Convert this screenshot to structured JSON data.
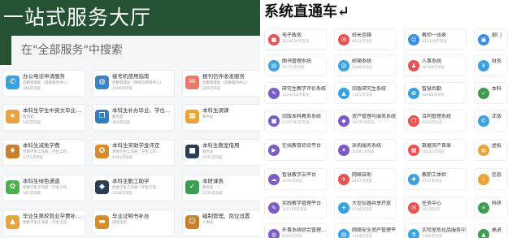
{
  "left_panel": {
    "title": "一站式服务大厅",
    "search_placeholder": "在\"全部服务\"中搜索",
    "cards": [
      {
        "title": "办公电话申请服务",
        "sub": "后勤管理处（后勤服务中心）",
        "count": "346次浏览",
        "icon": "phone-icon",
        "glyph": "✆",
        "color": "#3aa1e0"
      },
      {
        "title": "缓考机使用指南",
        "sub": "后勤管理处（网络与教育中心）",
        "count": "1490次浏览",
        "icon": "globe-icon",
        "glyph": "◍",
        "color": "#3b82c4"
      },
      {
        "title": "报刊信件收发服务",
        "sub": "后勤管理处（后勤服务中心）",
        "count": "224次浏览",
        "icon": "mail-icon",
        "glyph": "✉",
        "color": "#e9776a"
      },
      {
        "title": "本科生学生中英文毕业…",
        "sub": "教务处",
        "count": "502次浏览",
        "icon": "certificate-icon",
        "glyph": "★",
        "color": "#e8a33a"
      },
      {
        "title": "本科生补办毕业、学位…",
        "sub": "教务处",
        "count": "355次浏览",
        "icon": "document-icon",
        "glyph": "❐",
        "color": "#2f7fbf"
      },
      {
        "title": "本科生调课",
        "sub": "教务处",
        "count": "",
        "icon": "schedule-icon",
        "glyph": "▦",
        "color": "#e8a33a"
      },
      {
        "title": "本科生减免学费",
        "sub": "党委学生工作部（学生工作…",
        "count": "1371次浏览",
        "icon": "shield-icon",
        "glyph": "♦",
        "color": "#c9802a"
      },
      {
        "title": "本科生奖助学金评定",
        "sub": "党委学生工作部（学生工作…",
        "count": "4191次浏览",
        "icon": "award-icon",
        "glyph": "✪",
        "color": "#d98b2b"
      },
      {
        "title": "本科生教室借用",
        "sub": "教务处",
        "count": "3743次浏览",
        "icon": "classroom-icon",
        "glyph": "■",
        "color": "#2b3d52"
      },
      {
        "title": "本科生绿色通道",
        "sub": "党委学生工作部（学生工作…",
        "count": "343次浏览",
        "icon": "leaf-icon",
        "glyph": "✿",
        "color": "#4caf50"
      },
      {
        "title": "本科生勤工助学",
        "sub": "党委学生工作部（学生工作…",
        "count": "3336次浏览",
        "icon": "stack-icon",
        "glyph": "◆",
        "color": "#2b3d52"
      },
      {
        "title": "本研课表",
        "sub": "教务处",
        "count": "3735次浏览",
        "icon": "book-icon",
        "glyph": "✓",
        "color": "#3f9b4f"
      },
      {
        "title": "毕业生离校就业学费补…",
        "sub": "党委学生工作部（学生工作…",
        "count": "",
        "icon": "graduation-icon",
        "glyph": "▲",
        "color": "#e8a33a"
      },
      {
        "title": "毕业证明书补办",
        "sub": "研究生院",
        "count": "",
        "icon": "diploma-icon",
        "glyph": "▬",
        "color": "#d98b2b"
      },
      {
        "title": "编制管理、岗位设置",
        "sub": "人事处",
        "count": "",
        "icon": "user-icon",
        "glyph": "☺",
        "color": "#c9802a"
      }
    ]
  },
  "right_panel": {
    "title": "系统直通车↵",
    "cards": [
      {
        "title": "电子政务",
        "count": "1634220次浏览",
        "icon": "government-icon",
        "glyph": "■",
        "color": "#e55353"
      },
      {
        "title": "校长信箱",
        "count": "6932次浏览",
        "icon": "mailbox-icon",
        "glyph": "✉",
        "color": "#e55353"
      },
      {
        "title": "教师一张表",
        "count": "311328次浏览",
        "icon": "form-icon",
        "glyph": "☺",
        "color": "#3a8ee0"
      },
      {
        "title": "部门",
        "count": "",
        "icon": "department-icon",
        "glyph": "▣",
        "color": "#3a8ee0"
      },
      {
        "title": "图书管理系统",
        "count": "74779次浏览",
        "icon": "library-icon",
        "glyph": "▤",
        "color": "#3aa1e0"
      },
      {
        "title": "邮箱系统",
        "count": "2008次浏览",
        "icon": "email-icon",
        "glyph": "@",
        "color": "#3aa1e0"
      },
      {
        "title": "人事系统",
        "count": "38148次浏览",
        "icon": "personnel-icon",
        "glyph": "♟",
        "color": "#e55353"
      },
      {
        "title": "财务",
        "count": "",
        "icon": "finance-icon",
        "glyph": "¥",
        "color": "#3aa1e0"
      },
      {
        "title": "研究生教学评价系统",
        "count": "1534218次浏览",
        "icon": "evaluation-icon",
        "glyph": "✎",
        "color": "#7b5cc4"
      },
      {
        "title": "旧版研究生系统",
        "count": "1325次浏览",
        "icon": "graduate-icon",
        "glyph": "▲",
        "color": "#3aa1e0"
      },
      {
        "title": "智慧后勤",
        "count": "42688次浏览",
        "icon": "logistics-icon",
        "glyph": "✿",
        "color": "#3aa1e0"
      },
      {
        "title": "本科",
        "count": "",
        "icon": "undergrad-icon",
        "glyph": "✓",
        "color": "#3f9b4f"
      },
      {
        "title": "旧版本科教务系统",
        "count": "2127783次浏览",
        "icon": "academic-icon",
        "glyph": "■",
        "color": "#7b5cc4"
      },
      {
        "title": "资产管理与服务系统",
        "count": "18375次浏览",
        "icon": "asset-icon",
        "glyph": "◆",
        "color": "#7b5cc4"
      },
      {
        "title": "合同管理系统",
        "count": "6353次浏览",
        "icon": "contract-icon",
        "glyph": "❐",
        "color": "#e55353"
      },
      {
        "title": "正版",
        "count": "",
        "icon": "license-icon",
        "glyph": "©",
        "color": "#3aa1e0"
      },
      {
        "title": "在线教育综合平台",
        "count": "",
        "icon": "education-icon",
        "glyph": "▶",
        "color": "#7b5cc4"
      },
      {
        "title": "采购服务系统",
        "count": "20091次浏览",
        "icon": "purchase-icon",
        "glyph": "✦",
        "color": "#7b5cc4"
      },
      {
        "title": "数据资产目录",
        "count": "18541次浏览",
        "icon": "data-icon",
        "glyph": "▦",
        "color": "#e55353"
      },
      {
        "title": "虚拟",
        "count": "",
        "icon": "virtual-icon",
        "glyph": "◍",
        "color": "#e8a33a"
      },
      {
        "title": "智慧教学云平台",
        "count": "1540次浏览",
        "icon": "cloud-icon",
        "glyph": "☁",
        "color": "#7b5cc4"
      },
      {
        "title": "网络自助",
        "count": "2407次浏览",
        "icon": "network-icon",
        "glyph": "✈",
        "color": "#e55353"
      },
      {
        "title": "教职工体检",
        "count": "1737次浏览",
        "icon": "health-icon",
        "glyph": "✚",
        "color": "#3aa1e0"
      },
      {
        "title": "信息",
        "count": "",
        "icon": "info-icon",
        "glyph": "i",
        "color": "#e8a33a"
      },
      {
        "title": "实践教学管理平台",
        "count": "765795次浏览",
        "icon": "practice-icon",
        "glyph": "✎",
        "color": "#7b5cc4"
      },
      {
        "title": "大型仪器共享开放",
        "count": "4744次浏览",
        "icon": "instrument-icon",
        "glyph": "✦",
        "color": "#3aa1e0"
      },
      {
        "title": "任务中心",
        "count": "312次浏览",
        "icon": "task-icon",
        "glyph": "✉",
        "color": "#e55353"
      },
      {
        "title": "科研",
        "count": "",
        "icon": "research-icon",
        "glyph": "⚛",
        "color": "#3f9b4f"
      },
      {
        "title": "外事系统综合管理…",
        "count": "8390次浏览",
        "icon": "foreign-affairs-icon",
        "glyph": "◍",
        "color": "#7b5cc4"
      },
      {
        "title": "网络安全资产管理平台",
        "count": "1184次浏览",
        "icon": "security-icon",
        "glyph": "▤",
        "color": "#3aa1e0"
      },
      {
        "title": "实验室危化品服务中…",
        "count": "1180次浏览",
        "icon": "chemical-icon",
        "glyph": "⚗",
        "color": "#3aa1e0"
      },
      {
        "title": "高进",
        "count": "",
        "icon": "advanced-icon",
        "glyph": "▲",
        "color": "#3f9b4f"
      }
    ]
  }
}
